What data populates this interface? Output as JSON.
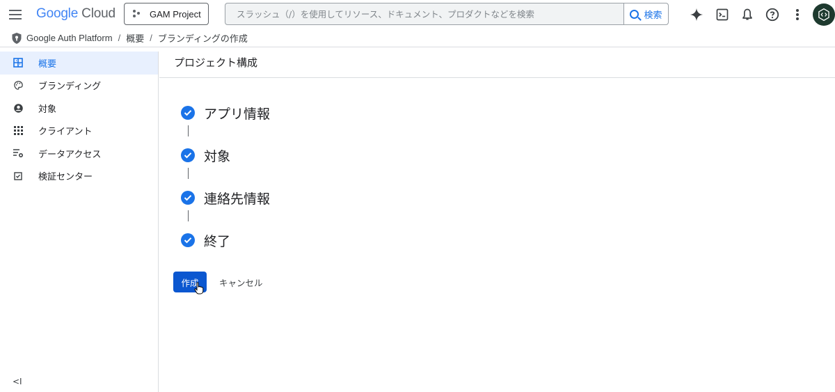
{
  "topbar": {
    "logo_google": "Google",
    "logo_cloud": "Cloud",
    "project_name": "GAM Project",
    "search_placeholder": "スラッシュ（/）を使用してリソース、ドキュメント、プロダクトなどを検索",
    "search_button": "検索",
    "icons": [
      "menu-icon",
      "gemini-spark-icon",
      "terminal-icon",
      "bell-icon",
      "help-icon",
      "more-vert-icon",
      "avatar"
    ]
  },
  "breadcrumb": {
    "items": [
      "Google Auth Platform",
      "概要",
      "ブランディングの作成"
    ],
    "separator": "/"
  },
  "sidebar": {
    "items": [
      {
        "label": "概要",
        "icon": "dashboard-icon",
        "active": true
      },
      {
        "label": "ブランディング",
        "icon": "palette-icon",
        "active": false
      },
      {
        "label": "対象",
        "icon": "account-circle-icon",
        "active": false
      },
      {
        "label": "クライアント",
        "icon": "apps-grid-icon",
        "active": false
      },
      {
        "label": "データアクセス",
        "icon": "list-settings-icon",
        "active": false
      },
      {
        "label": "検証センター",
        "icon": "checkbox-icon",
        "active": false
      }
    ],
    "collapse_label": "<I"
  },
  "main": {
    "title": "プロジェクト構成",
    "steps": [
      {
        "label": "アプリ情報",
        "complete": true
      },
      {
        "label": "対象",
        "complete": true
      },
      {
        "label": "連絡先情報",
        "complete": true
      },
      {
        "label": "終了",
        "complete": true
      }
    ],
    "create_button": "作成",
    "cancel_button": "キャンセル"
  },
  "colors": {
    "accent": "#1a73e8",
    "primary_button": "#0b57d0",
    "active_nav_bg": "#e8f0fe",
    "divider": "#dadce0"
  }
}
